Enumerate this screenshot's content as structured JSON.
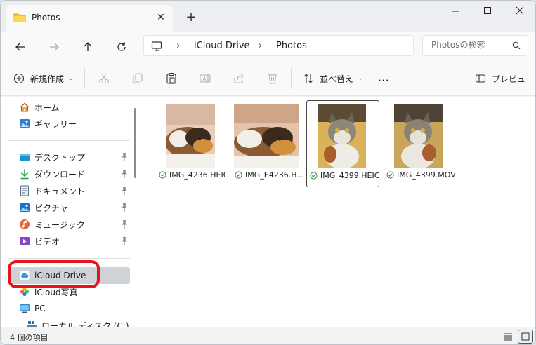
{
  "tab": {
    "title": "Photos",
    "close_glyph": "✕",
    "new_glyph": "+"
  },
  "breadcrumb": [
    "iCloud Drive",
    "Photos"
  ],
  "search": {
    "placeholder": "Photosの検索"
  },
  "toolbar": {
    "new_label": "新規作成",
    "sort_label": "並べ替え",
    "more_label": "...",
    "preview_label": "プレビュー"
  },
  "sidebar": {
    "items": [
      {
        "label": "ホーム",
        "icon": "home-icon"
      },
      {
        "label": "ギャラリー",
        "icon": "gallery-icon"
      },
      {
        "label": "デスクトップ",
        "icon": "desktop-icon",
        "pinned": true
      },
      {
        "label": "ダウンロード",
        "icon": "download-icon",
        "pinned": true
      },
      {
        "label": "ドキュメント",
        "icon": "documents-icon",
        "pinned": true
      },
      {
        "label": "ピクチャ",
        "icon": "pictures-icon",
        "pinned": true
      },
      {
        "label": "ミュージック",
        "icon": "music-icon",
        "pinned": true
      },
      {
        "label": "ビデオ",
        "icon": "videos-icon",
        "pinned": true
      },
      {
        "label": "iCloud Drive",
        "icon": "icloud-icon",
        "selected": true
      },
      {
        "label": "iCloud写真",
        "icon": "icloud-photos-icon"
      },
      {
        "label": "PC",
        "icon": "pc-icon"
      },
      {
        "label": "ローカル ディスク (C:)",
        "icon": "drive-icon"
      }
    ]
  },
  "files": [
    {
      "name": "IMG_4236.HEIC",
      "status": "synced"
    },
    {
      "name": "IMG_E4236.H...",
      "status": "synced"
    },
    {
      "name": "IMG_4399.HEIC",
      "status": "synced",
      "selected": true
    },
    {
      "name": "IMG_4399.MOV",
      "status": "synced"
    }
  ],
  "status": {
    "item_count": "4 個の項目"
  },
  "colors": {
    "accent": "#0067c0",
    "highlight_ring": "#e8141d",
    "sync_green": "#2e8b3a"
  }
}
